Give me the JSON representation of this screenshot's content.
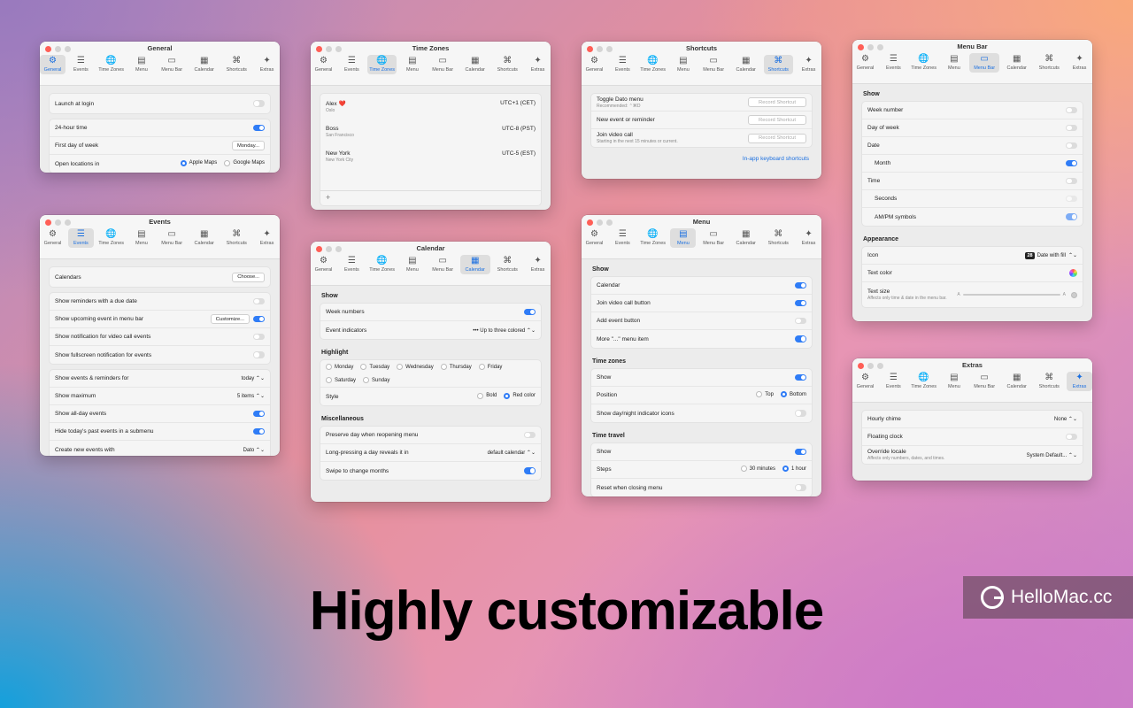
{
  "toolbar_tabs": [
    {
      "label": "General",
      "icon": "gear-icon"
    },
    {
      "label": "Events",
      "icon": "list-icon"
    },
    {
      "label": "Time Zones",
      "icon": "globe-icon"
    },
    {
      "label": "Menu",
      "icon": "menu-icon"
    },
    {
      "label": "Menu Bar",
      "icon": "menubar-icon"
    },
    {
      "label": "Calendar",
      "icon": "calendar-icon"
    },
    {
      "label": "Shortcuts",
      "icon": "command-icon"
    },
    {
      "label": "Extras",
      "icon": "sparkles-icon"
    }
  ],
  "general": {
    "title": "General",
    "launch": "Launch at login",
    "h24": "24-hour time",
    "first_day": "First day of week",
    "first_day_value": "Monday...",
    "open_loc": "Open locations in",
    "apple_maps": "Apple Maps",
    "google_maps": "Google Maps"
  },
  "timezones": {
    "title": "Time Zones",
    "items": [
      {
        "name": "Alex ❤️",
        "city": "Oslo",
        "offset": "UTC+1 (CET)"
      },
      {
        "name": "Boss",
        "city": "San Francisco",
        "offset": "UTC-8 (PST)"
      },
      {
        "name": "New York",
        "city": "New York City",
        "offset": "UTC-5 (EST)"
      }
    ],
    "add": "+"
  },
  "shortcuts": {
    "title": "Shortcuts",
    "toggle": "Toggle Dato menu",
    "toggle_sub": "Recommended: ⌃⌘D",
    "new_event": "New event or reminder",
    "join": "Join video call",
    "join_sub": "Starting in the next 15 minutes or current.",
    "record": "Record Shortcut",
    "link": "In-app keyboard shortcuts"
  },
  "menubar": {
    "title": "Menu Bar",
    "show": "Show",
    "week_number": "Week number",
    "day_of_week": "Day of week",
    "date": "Date",
    "month": "Month",
    "time": "Time",
    "seconds": "Seconds",
    "ampm": "AM/PM symbols",
    "appearance": "Appearance",
    "icon": "Icon",
    "icon_value": "Date with fill",
    "icon_day": "28",
    "text_color": "Text color",
    "text_size": "Text size",
    "text_size_sub": "Affects only time & date in the menu bar.",
    "a_small": "A",
    "a_large": "A"
  },
  "events": {
    "title": "Events",
    "calendars": "Calendars",
    "choose": "Choose...",
    "reminders": "Show reminders with a due date",
    "upcoming": "Show upcoming event in menu bar",
    "customize": "Customize...",
    "notif_video": "Show notification for video call events",
    "fullscreen": "Show fullscreen notification for events",
    "show_for": "Show events & reminders for",
    "show_for_value": "today",
    "maximum": "Show maximum",
    "maximum_value": "5 items",
    "all_day": "Show all-day events",
    "hide_past": "Hide today's past events in a submenu",
    "create_with": "Create new events with",
    "create_with_value": "Dato"
  },
  "calendar": {
    "title": "Calendar",
    "show": "Show",
    "week_numbers": "Week numbers",
    "indicators": "Event indicators",
    "indicators_value": "••• Up to three colored",
    "highlight": "Highlight",
    "days": [
      "Monday",
      "Tuesday",
      "Wednesday",
      "Thursday",
      "Friday",
      "Saturday",
      "Sunday"
    ],
    "style": "Style",
    "bold": "Bold",
    "red": "Red color",
    "misc": "Miscellaneous",
    "preserve": "Preserve day when reopening menu",
    "long_press": "Long-pressing a day reveals it in",
    "long_press_value": "default calendar",
    "swipe": "Swipe to change months"
  },
  "menu": {
    "title": "Menu",
    "show": "Show",
    "calendar": "Calendar",
    "join_btn": "Join video call button",
    "add_btn": "Add event button",
    "more_item": "More \"...\" menu item",
    "tz": "Time zones",
    "tz_show": "Show",
    "position": "Position",
    "top": "Top",
    "bottom": "Bottom",
    "daynight": "Show day/night indicator icons",
    "travel": "Time travel",
    "travel_show": "Show",
    "steps": "Steps",
    "m30": "30 minutes",
    "h1": "1 hour",
    "reset": "Reset when closing menu"
  },
  "extras": {
    "title": "Extras",
    "chime": "Hourly chime",
    "chime_value": "None",
    "floating": "Floating clock",
    "locale": "Override locale",
    "locale_sub": "Affects only numbers, dates, and times.",
    "locale_value": "System Default..."
  },
  "headline": "Highly customizable",
  "logo_text": "HelloMac.cc",
  "colors": {
    "accent": "#2f7cf6",
    "toggle_off": "#dcdcdc"
  }
}
